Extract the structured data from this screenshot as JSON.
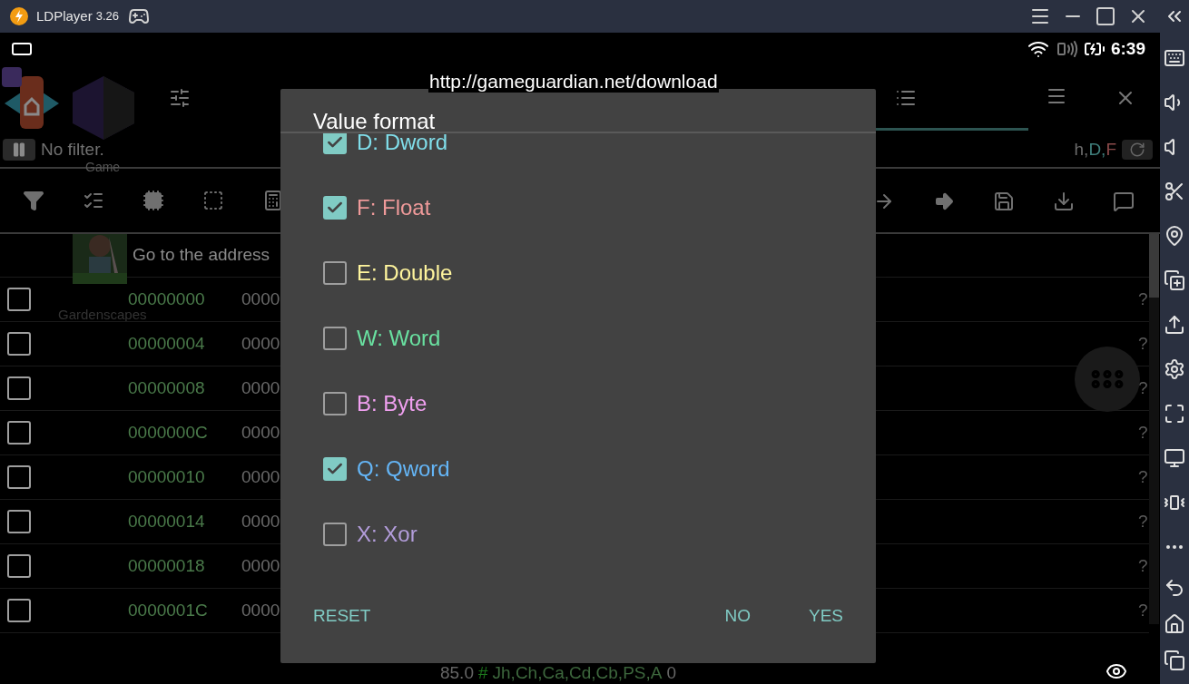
{
  "window": {
    "app_name": "LDPlayer",
    "version": "3.26"
  },
  "status_bar": {
    "time": "6:39"
  },
  "overlay_url": "http://gameguardian.net/download",
  "launcher_labels": [
    {
      "text": "Game"
    },
    {
      "text": "Gardenscapes"
    }
  ],
  "filter": {
    "text": "No filter."
  },
  "type_badges": [
    {
      "label": "h,",
      "color": "#6b6b6b"
    },
    {
      "label": "D,",
      "color": "#3f7f7c"
    },
    {
      "label": "F",
      "color": "#8a4a4a"
    }
  ],
  "goto_text": "Go to the address",
  "rows": [
    {
      "address": "00000000",
      "value": "0000",
      "checked": false,
      "flag": "?"
    },
    {
      "address": "00000004",
      "value": "0000",
      "checked": false,
      "flag": "?"
    },
    {
      "address": "00000008",
      "value": "0000",
      "checked": false,
      "flag": "?"
    },
    {
      "address": "0000000C",
      "value": "0000",
      "checked": false,
      "flag": "?"
    },
    {
      "address": "00000010",
      "value": "0000",
      "checked": false,
      "flag": "?"
    },
    {
      "address": "00000014",
      "value": "0000",
      "checked": false,
      "flag": "?"
    },
    {
      "address": "00000018",
      "value": "0000",
      "checked": false,
      "flag": "?"
    },
    {
      "address": "0000001C",
      "value": "0000",
      "checked": false,
      "flag": "?"
    }
  ],
  "bottom_bar": {
    "value": "85.0",
    "marker": "#",
    "regions": "Jh,Ch,Ca,Cd,Cb,PS,A",
    "count": "0"
  },
  "dialog": {
    "title": "Value format",
    "options": [
      {
        "label": "D: Dword",
        "checked": true,
        "color": "#80deea"
      },
      {
        "label": "F: Float",
        "checked": true,
        "color": "#ef9a9a"
      },
      {
        "label": "E: Double",
        "checked": false,
        "color": "#fff59d"
      },
      {
        "label": "W: Word",
        "checked": false,
        "color": "#69e0a0"
      },
      {
        "label": "B: Byte",
        "checked": false,
        "color": "#f0a0f0"
      },
      {
        "label": "Q: Qword",
        "checked": true,
        "color": "#64b5f6"
      },
      {
        "label": "X: Xor",
        "checked": false,
        "color": "#b39ddb"
      }
    ],
    "buttons": [
      {
        "label": "RESET"
      },
      {
        "label": "NO"
      },
      {
        "label": "YES"
      }
    ]
  }
}
